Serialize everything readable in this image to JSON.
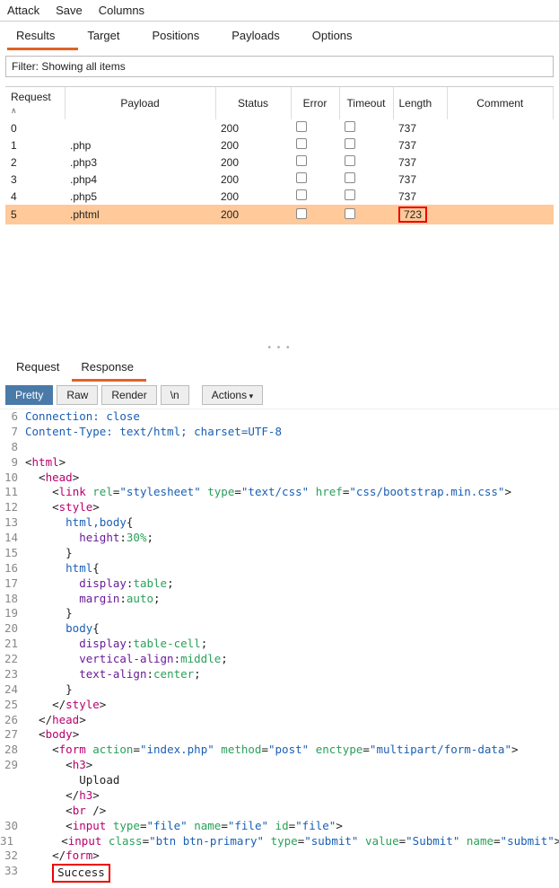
{
  "menubar": {
    "attack": "Attack",
    "save": "Save",
    "columns": "Columns"
  },
  "main_tabs": {
    "results": "Results",
    "target": "Target",
    "positions": "Positions",
    "payloads": "Payloads",
    "options": "Options"
  },
  "filter": {
    "label": "Filter: Showing all items"
  },
  "columns": {
    "request": "Request",
    "payload": "Payload",
    "status": "Status",
    "error": "Error",
    "timeout": "Timeout",
    "length": "Length",
    "comment": "Comment"
  },
  "rows": [
    {
      "req": "0",
      "payload": "",
      "status": "200",
      "length": "737"
    },
    {
      "req": "1",
      "payload": ".php",
      "status": "200",
      "length": "737"
    },
    {
      "req": "2",
      "payload": ".php3",
      "status": "200",
      "length": "737"
    },
    {
      "req": "3",
      "payload": ".php4",
      "status": "200",
      "length": "737"
    },
    {
      "req": "4",
      "payload": ".php5",
      "status": "200",
      "length": "737"
    },
    {
      "req": "5",
      "payload": ".phtml",
      "status": "200",
      "length": "723"
    }
  ],
  "detail_tabs": {
    "request": "Request",
    "response": "Response"
  },
  "view_bar": {
    "pretty": "Pretty",
    "raw": "Raw",
    "render": "Render",
    "nl": "\\n",
    "actions": "Actions"
  },
  "response": {
    "l6": "Connection: close",
    "l7": "Content-Type: text/html; charset=UTF-8",
    "l8": "",
    "l9_tag": "html",
    "l10_tag": "head",
    "l11": {
      "tag": "link",
      "rel": "stylesheet",
      "type": "text/css",
      "href_attr": "href",
      "href": "css/bootstrap.min.css"
    },
    "l12_tag": "style",
    "l13_sel": "html,body",
    "l13_open": "{",
    "l14_prop": "height",
    "l14_val": "30%",
    "l15_close": "}",
    "l16_sel": "html",
    "l16_open": "{",
    "l17_prop": "display",
    "l17_val": "table",
    "l18_prop": "margin",
    "l18_val": "auto",
    "l19_close": "}",
    "l20_sel": "body",
    "l20_open": "{",
    "l21_prop": "display",
    "l21_val": "table-cell",
    "l22_prop": "vertical-align",
    "l22_val": "middle",
    "l23_prop": "text-align",
    "l23_val": "center",
    "l24_close": "}",
    "l25_tag": "style",
    "l26_tag": "head",
    "l27_tag": "body",
    "l28": {
      "tag": "form",
      "action": "index.php",
      "method": "post",
      "enctype": "multipart/form-data"
    },
    "l29a_tag": "h3",
    "l29b_text": "Upload",
    "l29c_tag": "h3",
    "l29d_tag": "br",
    "l30": {
      "tag": "input",
      "type": "file",
      "name": "file",
      "id": "file"
    },
    "l31": {
      "tag": "input",
      "class": "btn btn-primary",
      "type": "submit",
      "value": "Submit",
      "name": "submit"
    },
    "l32_tag": "form",
    "l33_text": "Success"
  },
  "line_numbers": {
    "n6": "6",
    "n7": "7",
    "n8": "8",
    "n9": "9",
    "n10": "10",
    "n11": "11",
    "n12": "12",
    "n13": "13",
    "n14": "14",
    "n15": "15",
    "n16": "16",
    "n17": "17",
    "n18": "18",
    "n19": "19",
    "n20": "20",
    "n21": "21",
    "n22": "22",
    "n23": "23",
    "n24": "24",
    "n25": "25",
    "n26": "26",
    "n27": "27",
    "n28": "28",
    "n29": "29",
    "n30": "30",
    "n31": "31",
    "n32": "32",
    "n33": "33"
  }
}
